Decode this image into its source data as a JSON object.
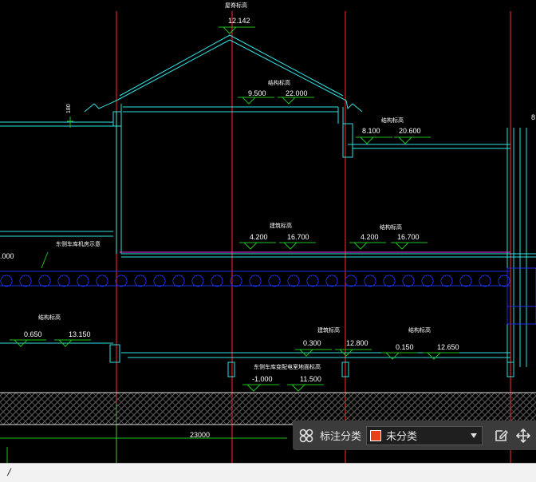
{
  "drawing": {
    "ridge": {
      "title": "屋脊标高",
      "value": "12.142"
    },
    "roof_labels": [
      {
        "title": "结构标高",
        "v1": "9.500",
        "v2": "22.000"
      },
      {
        "title": "结构标高",
        "v1": "8.100",
        "v2": "20.600"
      }
    ],
    "partial": "8",
    "dim_180": "180",
    "floor_labels": [
      {
        "title": "建筑标高",
        "v1": "4.200",
        "v2": "16.700"
      },
      {
        "title": "结构标高",
        "v1": "4.200",
        "v2": "16.700"
      }
    ],
    "side_note": "东侧车库机房示意",
    "left_value": ".000",
    "lower_labels": [
      {
        "title": "结构标高",
        "v1": "0.650",
        "v2": "13.150"
      },
      {
        "title": "建筑标高",
        "v1": "0.300",
        "v2": "12.800"
      },
      {
        "title": "结构标高",
        "v1": "0.150",
        "v2": "12.650"
      }
    ],
    "basement": {
      "title": "东侧车库变配电室地面标高",
      "v1": "-1.000",
      "v2": "11.500"
    },
    "total_dim": "23000"
  },
  "toolbar": {
    "icon": "grid-icon",
    "label": "标注分类",
    "category_value": "未分类",
    "category_color": "#e8401a",
    "edit_icon": "edit-icon",
    "move_icon": "move-icon"
  },
  "command_line": {
    "value": "/"
  }
}
